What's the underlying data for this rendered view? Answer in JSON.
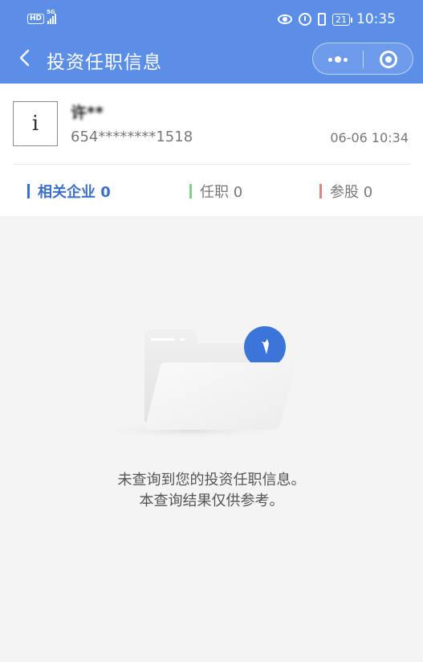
{
  "status_bar": {
    "hd_label": "HD",
    "network_label": "5G",
    "battery": "21",
    "time": "10:35"
  },
  "nav": {
    "title": "投资任职信息"
  },
  "person": {
    "avatar_letter": "i",
    "name": "许**",
    "id_number": "654********1518",
    "update_time": "06-06 10:34"
  },
  "tabs": [
    {
      "label": "相关企业 0",
      "color": "#3b6fc5"
    },
    {
      "label": "任职 0",
      "color": "#7fd08a"
    },
    {
      "label": "参股 0",
      "color": "#d8867f"
    }
  ],
  "empty_state": {
    "line1": "未查询到您的投资任职信息。",
    "line2": "本查询结果仅供参考。"
  },
  "colors": {
    "header_bg": "#5b8ee6",
    "accent": "#3b6fc5"
  }
}
